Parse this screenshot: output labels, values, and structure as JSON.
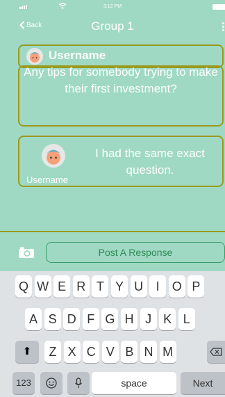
{
  "status": {
    "time": "3:12 PM"
  },
  "nav": {
    "back_label": "Back",
    "title": "Group 1"
  },
  "question": {
    "username": "Username",
    "text": "Any tips for somebody trying to make their first investment?"
  },
  "reply": {
    "username": "Username",
    "text": "I had the same exact question."
  },
  "composer": {
    "post_label": "Post A Response"
  },
  "keyboard": {
    "row1": [
      "Q",
      "W",
      "E",
      "R",
      "T",
      "Y",
      "U",
      "I",
      "O",
      "P"
    ],
    "row2": [
      "A",
      "S",
      "D",
      "F",
      "G",
      "H",
      "J",
      "K",
      "L"
    ],
    "row3": [
      "Z",
      "X",
      "C",
      "V",
      "B",
      "N",
      "M"
    ],
    "numbers_label": "123",
    "space_label": "space",
    "next_label": "Next"
  },
  "colors": {
    "background": "#9fd9c4",
    "card_border": "#9a9a1e",
    "button_text": "#2f8a55"
  }
}
